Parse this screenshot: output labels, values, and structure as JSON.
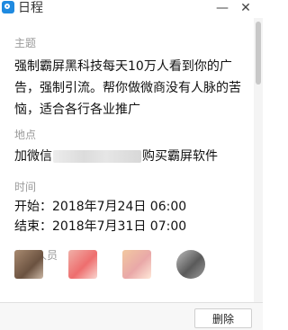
{
  "window": {
    "title": "日程",
    "minimize_glyph": "—",
    "close_glyph": "✕"
  },
  "topic": {
    "label": "主题",
    "text": "强制霸屏黑科技每天10万人看到你的广告，强制引流。帮你做微商没有人脉的苦恼，适合各行各业推广"
  },
  "location": {
    "label": "地点",
    "prefix": "加微信",
    "suffix": "购买霸屏软件"
  },
  "time": {
    "label": "时间",
    "start": "开始：2018年7月24日 06:00",
    "end": "结束：2018年7月31日 07:00"
  },
  "participants": {
    "label": "参与人员"
  },
  "footer": {
    "delete_label": "删除"
  }
}
